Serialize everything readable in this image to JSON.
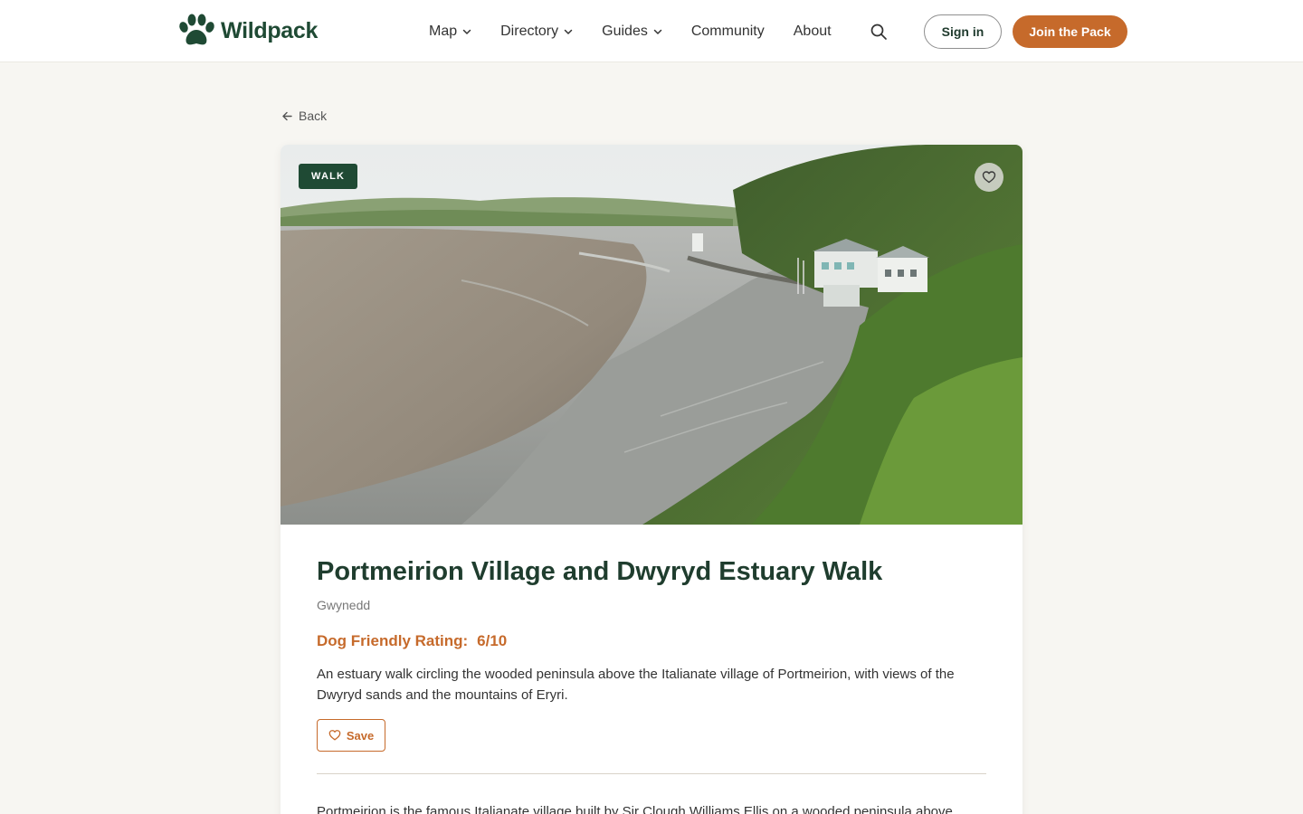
{
  "header": {
    "brand": "Wildpack",
    "nav": [
      {
        "label": "Map",
        "dropdown": true
      },
      {
        "label": "Directory",
        "dropdown": true
      },
      {
        "label": "Guides",
        "dropdown": true
      },
      {
        "label": "Community",
        "dropdown": false
      },
      {
        "label": "About",
        "dropdown": false
      }
    ],
    "sign_in": "Sign in",
    "join": "Join the Pack"
  },
  "back_label": "Back",
  "listing": {
    "badge": "WALK",
    "title": "Portmeirion Village and Dwyryd Estuary Walk",
    "region": "Gwynedd",
    "rating_label": "Dog Friendly Rating:",
    "rating_value": "6/10",
    "description": "An estuary walk circling the wooded peninsula above the Italianate village of Portmeirion, with views of the Dwyryd sands and the mountains of Eryri.",
    "save_label": "Save",
    "body_start": "Portmeirion is the famous Italianate village built by Sir Clough Williams Ellis on a wooded peninsula above"
  },
  "icons": {
    "logo": "paw-icon",
    "search": "search-icon",
    "favourite": "heart-icon",
    "back": "arrow-left-icon",
    "dropdown": "chevron-down-icon"
  },
  "colors": {
    "brand_green": "#1f4a34",
    "accent_orange": "#c66a2b",
    "page_bg": "#f7f6f2"
  }
}
